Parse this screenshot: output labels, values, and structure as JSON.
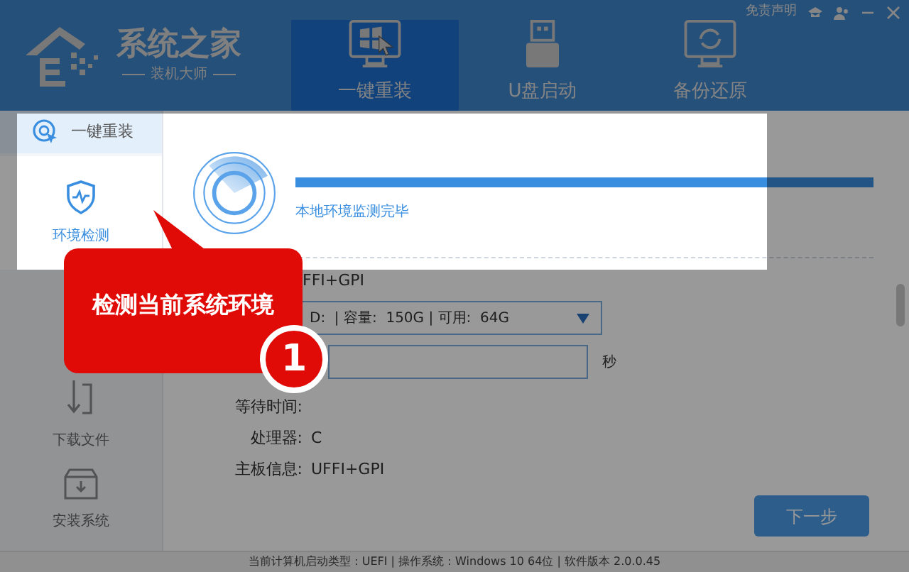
{
  "logo": {
    "title": "系统之家",
    "subtitle": "装机大师"
  },
  "top_links": {
    "disclaimer": "免责声明"
  },
  "top_nav": [
    {
      "label": "一键重装",
      "kind": "monitor",
      "selected": true
    },
    {
      "label": "U盘启动",
      "kind": "usb",
      "selected": false
    },
    {
      "label": "备份还原",
      "kind": "restore",
      "selected": false
    }
  ],
  "sidebar": {
    "header": "一键重装",
    "items": [
      {
        "label": "环境检测",
        "kind": "shield",
        "selected": true
      },
      {
        "label": "下载文件",
        "kind": "download",
        "selected": false
      },
      {
        "label": "安装系统",
        "kind": "install",
        "selected": false
      }
    ]
  },
  "detection": {
    "level": 1,
    "status": "本地环境监测完毕"
  },
  "form": {
    "top_value": "FFI+GPI",
    "disk_select": "D:  | 容量:  150G | 可用:  64G",
    "seconds_unit": "秒",
    "info": [
      {
        "label": "等待时间:"
      },
      {
        "label": "处理器:",
        "value": "C"
      },
      {
        "label": "主板信息:",
        "value": "UFFI+GPI"
      }
    ]
  },
  "callout": {
    "text": "检测当前系统环境",
    "step": "1"
  },
  "next_button": "下一步",
  "status_bar": "当前计算机启动类型：UEFI | 操作系统：Windows 10 64位 | 软件版本 2.0.0.45"
}
